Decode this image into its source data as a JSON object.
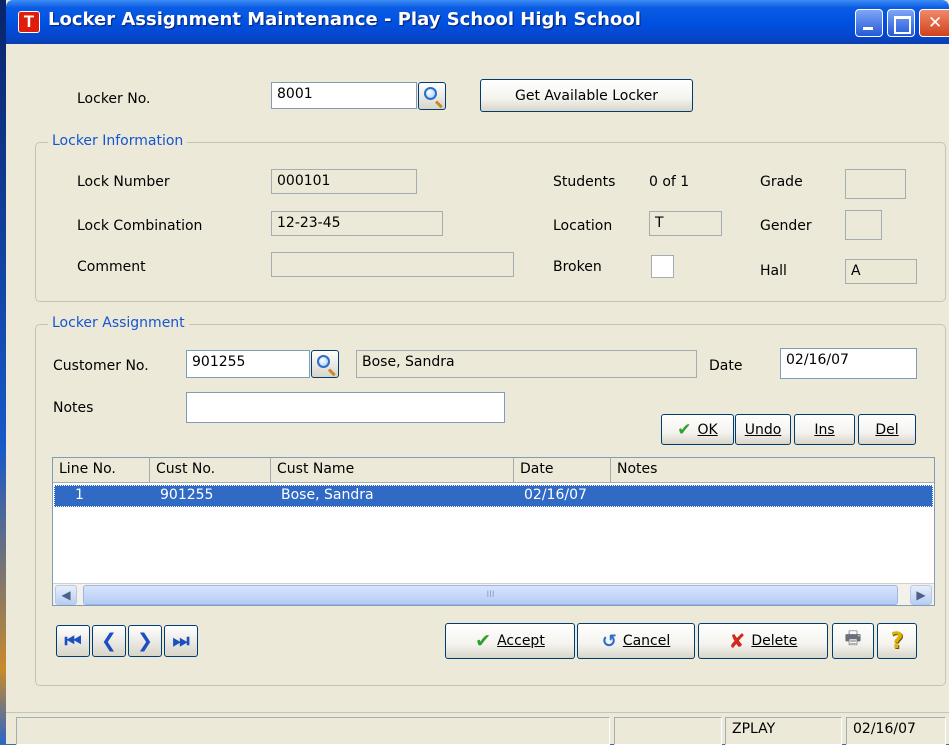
{
  "window": {
    "title": "Locker Assignment Maintenance - Play School High School",
    "icon_letter": "T"
  },
  "top": {
    "locker_no_label": "Locker No.",
    "locker_no_value": "8001",
    "get_available_label": "Get Available Locker"
  },
  "locker_info": {
    "title": "Locker Information",
    "lock_number_label": "Lock Number",
    "lock_number_value": "000101",
    "lock_combination_label": "Lock Combination",
    "lock_combination_value": "12-23-45",
    "comment_label": "Comment",
    "comment_value": "",
    "students_label": "Students",
    "students_value": "0 of 1",
    "location_label": "Location",
    "location_value": "T",
    "broken_label": "Broken",
    "grade_label": "Grade",
    "grade_value": "",
    "gender_label": "Gender",
    "gender_value": "",
    "hall_label": "Hall",
    "hall_value": "A"
  },
  "assignment": {
    "title": "Locker Assignment",
    "customer_no_label": "Customer No.",
    "customer_no_value": "901255",
    "customer_name_value": "Bose, Sandra",
    "date_label": "Date",
    "date_value": "02/16/07",
    "notes_label": "Notes",
    "notes_value": "",
    "ok_label": "OK",
    "undo_label": "Undo",
    "ins_label": "Ins",
    "del_label": "Del"
  },
  "grid": {
    "columns": [
      "Line No.",
      "Cust No.",
      "Cust Name",
      "Date",
      "Notes"
    ],
    "rows": [
      {
        "line": "1",
        "cust_no": "901255",
        "cust_name": "Bose, Sandra",
        "date": "02/16/07",
        "notes": ""
      }
    ],
    "scroll_grip": "III"
  },
  "actions": {
    "accept_label": "Accept",
    "cancel_label": "Cancel",
    "delete_label": "Delete"
  },
  "statusbar": {
    "company": "ZPLAY",
    "date": "02/16/07"
  }
}
